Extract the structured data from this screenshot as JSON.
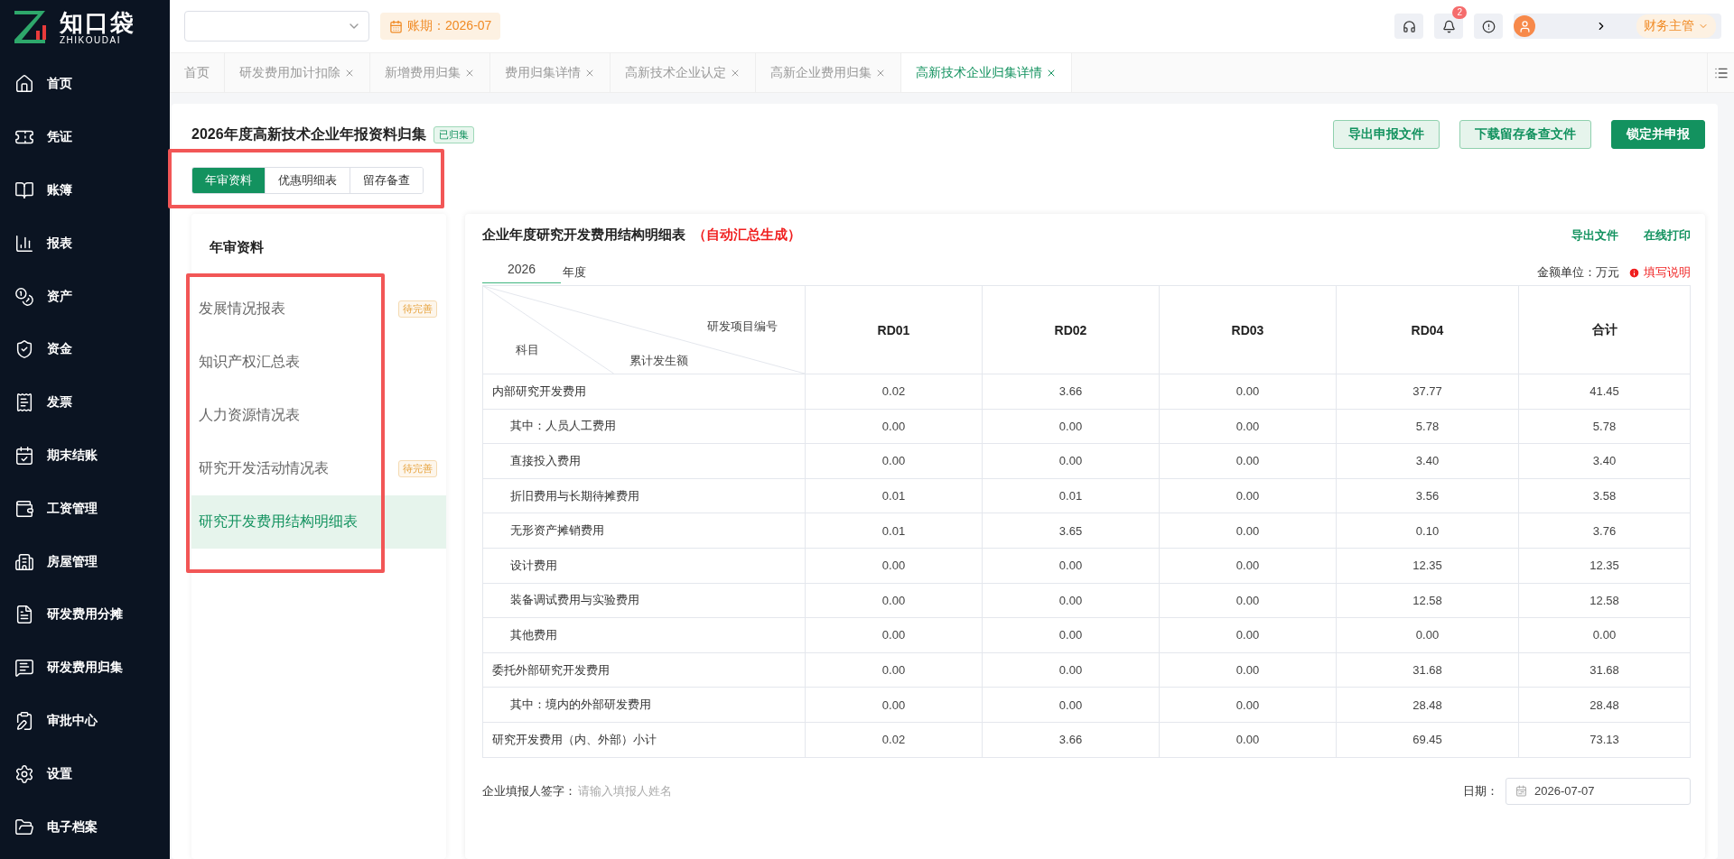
{
  "app": {
    "name": "知口袋",
    "subtitle": "ZHIKOUDAI"
  },
  "sidebar": {
    "items": [
      "首页",
      "凭证",
      "账簿",
      "报表",
      "资产",
      "资金",
      "发票",
      "期末结账",
      "工资管理",
      "房屋管理",
      "研发费用分摊",
      "研发费用归集",
      "审批中心",
      "设置",
      "电子档案"
    ]
  },
  "topbar": {
    "period": "账期：2026-07",
    "notification_count": "2",
    "role": "财务主管"
  },
  "tabs": [
    {
      "label": "首页",
      "selected": false,
      "closable": false
    },
    {
      "label": "研发费用加计扣除",
      "selected": false,
      "closable": true
    },
    {
      "label": "新增费用归集",
      "selected": false,
      "closable": true
    },
    {
      "label": "费用归集详情",
      "selected": false,
      "closable": true
    },
    {
      "label": "高新技术企业认定",
      "selected": false,
      "closable": true
    },
    {
      "label": "高新企业费用归集",
      "selected": false,
      "closable": true
    },
    {
      "label": "高新技术企业归集详情",
      "selected": true,
      "closable": true
    }
  ],
  "page": {
    "title": "2026年度高新技术企业年报资料归集",
    "status_badge": "已归集",
    "buttons": [
      {
        "label": "导出申报文件",
        "kind": "outline"
      },
      {
        "label": "下载留存备查文件",
        "kind": "outline"
      },
      {
        "label": "锁定并申报",
        "kind": "primary"
      }
    ],
    "segments": [
      {
        "label": "年审资料",
        "selected": true
      },
      {
        "label": "优惠明细表",
        "selected": false
      },
      {
        "label": "留存备查",
        "selected": false
      }
    ]
  },
  "report_list": {
    "title": "年审资料",
    "items": [
      {
        "label": "发展情况报表",
        "selected": false,
        "tag": "待完善"
      },
      {
        "label": "知识产权汇总表",
        "selected": false
      },
      {
        "label": "人力资源情况表",
        "selected": false
      },
      {
        "label": "研究开发活动情况表",
        "selected": false,
        "tag": "待完善"
      },
      {
        "label": "研究开发费用结构明细表",
        "selected": true
      }
    ]
  },
  "report": {
    "title": "企业年度研究开发费用结构明细表",
    "note": "（自动汇总生成）",
    "links": [
      "导出文件",
      "在线打印"
    ],
    "year": "2026",
    "year_suffix": "年度",
    "unit": "金额单位：万元",
    "help": "填写说明",
    "corner": {
      "top": "研发项目编号",
      "middle": "累计发生额",
      "left": "科目"
    },
    "columns": [
      "RD01",
      "RD02",
      "RD03",
      "RD04",
      "合计"
    ],
    "rows": [
      {
        "label": "内部研究开发费用",
        "values": [
          "0.02",
          "3.66",
          "0.00",
          "37.77",
          "41.45"
        ],
        "children": [
          {
            "label": "其中：人员人工费用",
            "values": [
              "0.00",
              "0.00",
              "0.00",
              "5.78",
              "5.78"
            ]
          },
          {
            "label": "直接投入费用",
            "values": [
              "0.00",
              "0.00",
              "0.00",
              "3.40",
              "3.40"
            ]
          },
          {
            "label": "折旧费用与长期待摊费用",
            "values": [
              "0.01",
              "0.01",
              "0.00",
              "3.56",
              "3.58"
            ]
          },
          {
            "label": "无形资产摊销费用",
            "values": [
              "0.01",
              "3.65",
              "0.00",
              "0.10",
              "3.76"
            ]
          },
          {
            "label": "设计费用",
            "values": [
              "0.00",
              "0.00",
              "0.00",
              "12.35",
              "12.35"
            ]
          },
          {
            "label": "装备调试费用与实验费用",
            "values": [
              "0.00",
              "0.00",
              "0.00",
              "12.58",
              "12.58"
            ]
          },
          {
            "label": "其他费用",
            "values": [
              "0.00",
              "0.00",
              "0.00",
              "0.00",
              "0.00"
            ]
          }
        ]
      },
      {
        "label": "委托外部研究开发费用",
        "values": [
          "0.00",
          "0.00",
          "0.00",
          "31.68",
          "31.68"
        ],
        "children": [
          {
            "label": "其中：境内的外部研发费用",
            "values": [
              "0.00",
              "0.00",
              "0.00",
              "28.48",
              "28.48"
            ]
          }
        ]
      },
      {
        "label": "研究开发费用（内、外部）小计",
        "values": [
          "0.02",
          "3.66",
          "0.00",
          "69.45",
          "73.13"
        ]
      }
    ],
    "footer": {
      "signer_label": "企业填报人签字：",
      "signer_placeholder": "请输入填报人姓名",
      "date_label": "日期：",
      "date_value": "2026-07-07"
    }
  }
}
